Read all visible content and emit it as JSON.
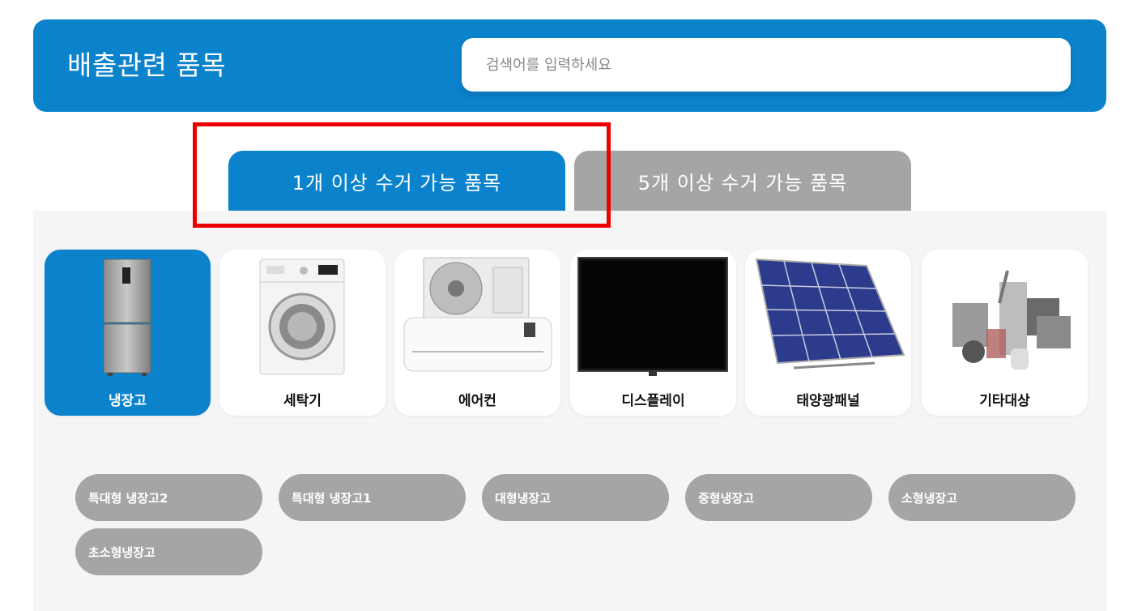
{
  "header": {
    "title": "배출관련 품목",
    "search_placeholder": "검색어를 입력하세요"
  },
  "tabs": [
    {
      "label": "1개 이상 수거 가능 품목",
      "active": true
    },
    {
      "label": "5개 이상 수거 가능 품목",
      "active": false
    }
  ],
  "categories": [
    {
      "label": "냉장고",
      "icon": "refrigerator-image",
      "active": true
    },
    {
      "label": "세탁기",
      "icon": "washing-machine-image",
      "active": false
    },
    {
      "label": "에어컨",
      "icon": "air-conditioner-image",
      "active": false
    },
    {
      "label": "디스플레이",
      "icon": "display-image",
      "active": false
    },
    {
      "label": "태양광패널",
      "icon": "solar-panel-image",
      "active": false
    },
    {
      "label": "기타대상",
      "icon": "appliances-image",
      "active": false
    }
  ],
  "subitems": [
    "특대형 냉장고2",
    "특대형 냉장고1",
    "대형냉장고",
    "중형냉장고",
    "소형냉장고",
    "초소형냉장고"
  ],
  "colors": {
    "accent": "#0a82cc",
    "inactive": "#a5a5a5",
    "panel": "#f5f5f5",
    "highlight": "#ee0000"
  }
}
